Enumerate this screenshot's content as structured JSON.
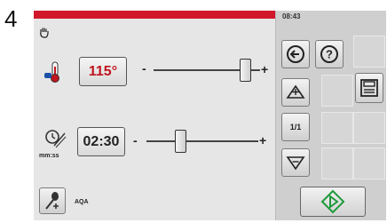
{
  "step_number": "4",
  "status": {
    "clock": "08:43"
  },
  "temperature": {
    "value": "115°",
    "minus": "-",
    "plus": "+",
    "level": 0.86,
    "icon": "thermometer-icon",
    "value_color": "#c0141e"
  },
  "timer": {
    "value": "02:30",
    "unit": "mm:ss",
    "minus": "-",
    "plus": "+",
    "level": 0.3,
    "icon": "timer-off-icon"
  },
  "probe": {
    "label": "AQA",
    "icon": "core-probe-icon"
  },
  "sidebar": {
    "ratio_label": "1/1",
    "icons": [
      "back-icon",
      "help-icon",
      "up-icon",
      "save-icon",
      "down-icon",
      "start-icon"
    ]
  },
  "colors": {
    "accent_red": "#d1182b",
    "start_green": "#1e9a3c"
  }
}
